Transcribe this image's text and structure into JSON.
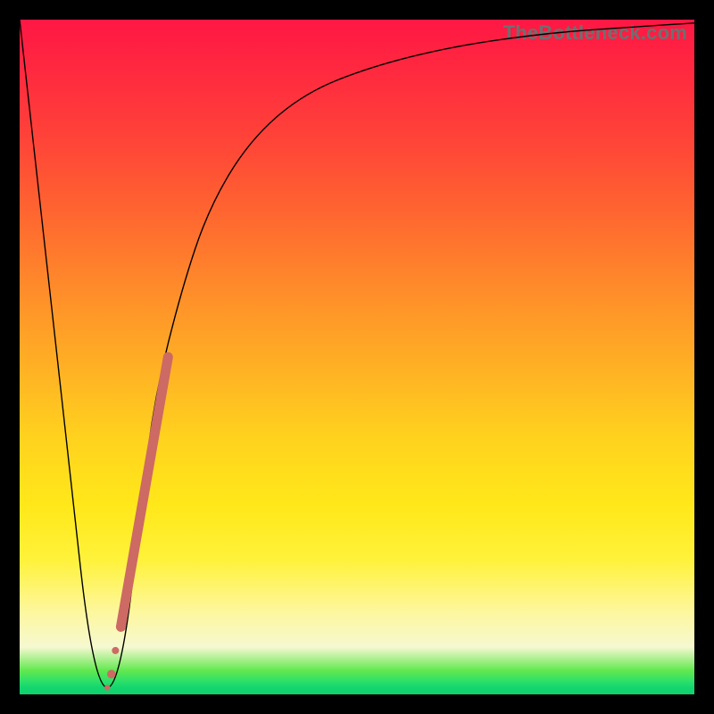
{
  "watermark": "TheBottleneck.com",
  "colors": {
    "frame": "#000000",
    "curve": "#000000",
    "marker": "#cc6a63"
  },
  "chart_data": {
    "type": "line",
    "title": "",
    "xlabel": "",
    "ylabel": "",
    "xlim": [
      0,
      100
    ],
    "ylim": [
      0,
      100
    ],
    "grid": false,
    "legend": false,
    "series": [
      {
        "name": "bottleneck-curve",
        "x": [
          0,
          4,
          8,
          10,
          12,
          14,
          16,
          18,
          20,
          24,
          28,
          34,
          42,
          52,
          64,
          78,
          92,
          100
        ],
        "y": [
          100,
          64,
          28,
          10,
          1,
          1,
          10,
          28,
          44,
          60,
          72,
          82,
          89,
          93,
          96,
          98,
          99,
          99.5
        ]
      }
    ],
    "markers": [
      {
        "name": "segment",
        "x0": 15.0,
        "y0": 10,
        "x1": 22.0,
        "y1": 50,
        "width": 11
      },
      {
        "name": "dot",
        "x": 14.2,
        "y": 6.5,
        "r": 4.0
      },
      {
        "name": "dot",
        "x": 13.6,
        "y": 3.0,
        "r": 4.8
      },
      {
        "name": "dot",
        "x": 13.0,
        "y": 1.0,
        "r": 3.2
      }
    ],
    "gradient_stops": [
      {
        "pos": 0,
        "color": "#ff1744"
      },
      {
        "pos": 40,
        "color": "#ff8c2a"
      },
      {
        "pos": 72,
        "color": "#ffe81a"
      },
      {
        "pos": 96,
        "color": "#61e84e"
      },
      {
        "pos": 100,
        "color": "#0fd26c"
      }
    ]
  }
}
